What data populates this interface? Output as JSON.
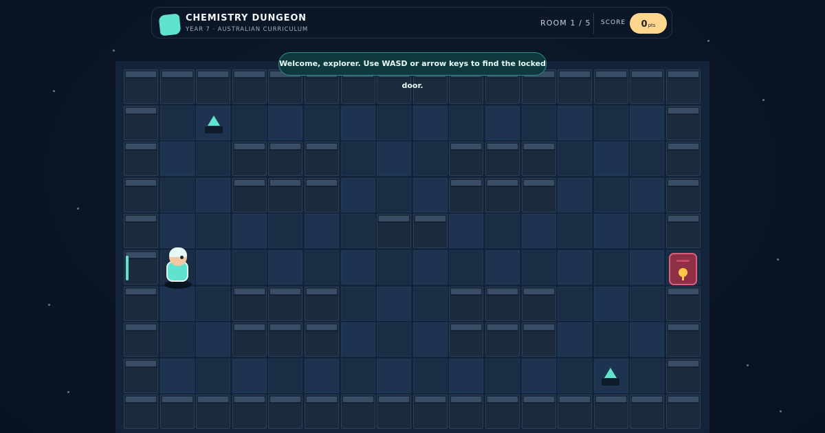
{
  "header": {
    "title": "CHEMISTRY DUNGEON",
    "subtitle": "YEAR 7 · AUSTRALIAN CURRICULUM",
    "room": "ROOM 1 / 5",
    "score_label": "SCORE",
    "score_value": "0",
    "score_unit": "pts"
  },
  "toast": {
    "message": "Welcome, explorer. Use WASD or arrow keys to find the locked door."
  },
  "colors": {
    "accent": "#5fe3cf",
    "score_pill": "#fcd68c",
    "door": "#8e2f45",
    "lock": "#fcc646"
  },
  "map": {
    "legend": "W = wall, . = floor",
    "rows": [
      "WWWWWWWWWWWWWWWW",
      "W..............W",
      "W..WWW...WWW...W",
      "W..WWW...WWW...W",
      "W......WW......W",
      "W..............D",
      "W..WWW...WWW...W",
      "W..WWW...WWW...W",
      "W..............W",
      "WWWWWWWWWWWWWWWW"
    ],
    "player": {
      "row": 5,
      "col": 1
    },
    "door": {
      "row": 5,
      "col": 15,
      "state": "locked",
      "icon": "keyhole-icon"
    },
    "pickups": [
      {
        "row": 1,
        "col": 2,
        "icon": "flask-icon"
      },
      {
        "row": 8,
        "col": 13,
        "icon": "flask-icon"
      }
    ]
  }
}
